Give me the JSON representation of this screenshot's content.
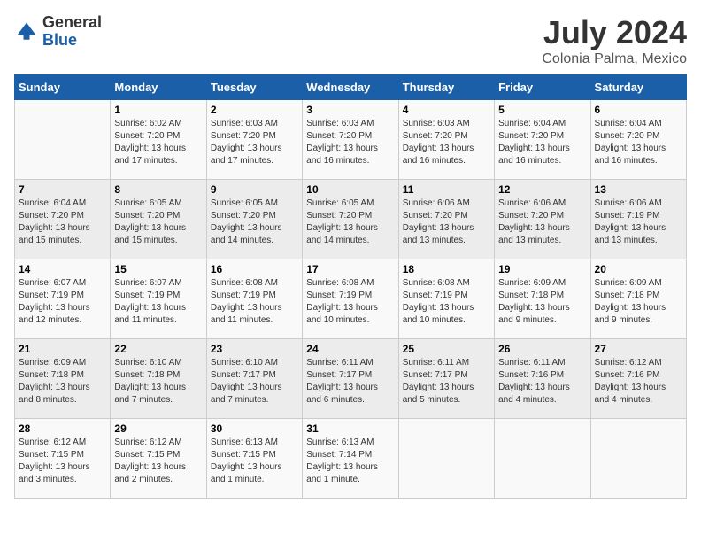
{
  "logo": {
    "general": "General",
    "blue": "Blue"
  },
  "title": "July 2024",
  "location": "Colonia Palma, Mexico",
  "days_of_week": [
    "Sunday",
    "Monday",
    "Tuesday",
    "Wednesday",
    "Thursday",
    "Friday",
    "Saturday"
  ],
  "weeks": [
    [
      {
        "day": "",
        "sunrise": "",
        "sunset": "",
        "daylight": ""
      },
      {
        "day": "1",
        "sunrise": "Sunrise: 6:02 AM",
        "sunset": "Sunset: 7:20 PM",
        "daylight": "Daylight: 13 hours and 17 minutes."
      },
      {
        "day": "2",
        "sunrise": "Sunrise: 6:03 AM",
        "sunset": "Sunset: 7:20 PM",
        "daylight": "Daylight: 13 hours and 17 minutes."
      },
      {
        "day": "3",
        "sunrise": "Sunrise: 6:03 AM",
        "sunset": "Sunset: 7:20 PM",
        "daylight": "Daylight: 13 hours and 16 minutes."
      },
      {
        "day": "4",
        "sunrise": "Sunrise: 6:03 AM",
        "sunset": "Sunset: 7:20 PM",
        "daylight": "Daylight: 13 hours and 16 minutes."
      },
      {
        "day": "5",
        "sunrise": "Sunrise: 6:04 AM",
        "sunset": "Sunset: 7:20 PM",
        "daylight": "Daylight: 13 hours and 16 minutes."
      },
      {
        "day": "6",
        "sunrise": "Sunrise: 6:04 AM",
        "sunset": "Sunset: 7:20 PM",
        "daylight": "Daylight: 13 hours and 16 minutes."
      }
    ],
    [
      {
        "day": "7",
        "sunrise": "Sunrise: 6:04 AM",
        "sunset": "Sunset: 7:20 PM",
        "daylight": "Daylight: 13 hours and 15 minutes."
      },
      {
        "day": "8",
        "sunrise": "Sunrise: 6:05 AM",
        "sunset": "Sunset: 7:20 PM",
        "daylight": "Daylight: 13 hours and 15 minutes."
      },
      {
        "day": "9",
        "sunrise": "Sunrise: 6:05 AM",
        "sunset": "Sunset: 7:20 PM",
        "daylight": "Daylight: 13 hours and 14 minutes."
      },
      {
        "day": "10",
        "sunrise": "Sunrise: 6:05 AM",
        "sunset": "Sunset: 7:20 PM",
        "daylight": "Daylight: 13 hours and 14 minutes."
      },
      {
        "day": "11",
        "sunrise": "Sunrise: 6:06 AM",
        "sunset": "Sunset: 7:20 PM",
        "daylight": "Daylight: 13 hours and 13 minutes."
      },
      {
        "day": "12",
        "sunrise": "Sunrise: 6:06 AM",
        "sunset": "Sunset: 7:20 PM",
        "daylight": "Daylight: 13 hours and 13 minutes."
      },
      {
        "day": "13",
        "sunrise": "Sunrise: 6:06 AM",
        "sunset": "Sunset: 7:19 PM",
        "daylight": "Daylight: 13 hours and 13 minutes."
      }
    ],
    [
      {
        "day": "14",
        "sunrise": "Sunrise: 6:07 AM",
        "sunset": "Sunset: 7:19 PM",
        "daylight": "Daylight: 13 hours and 12 minutes."
      },
      {
        "day": "15",
        "sunrise": "Sunrise: 6:07 AM",
        "sunset": "Sunset: 7:19 PM",
        "daylight": "Daylight: 13 hours and 11 minutes."
      },
      {
        "day": "16",
        "sunrise": "Sunrise: 6:08 AM",
        "sunset": "Sunset: 7:19 PM",
        "daylight": "Daylight: 13 hours and 11 minutes."
      },
      {
        "day": "17",
        "sunrise": "Sunrise: 6:08 AM",
        "sunset": "Sunset: 7:19 PM",
        "daylight": "Daylight: 13 hours and 10 minutes."
      },
      {
        "day": "18",
        "sunrise": "Sunrise: 6:08 AM",
        "sunset": "Sunset: 7:19 PM",
        "daylight": "Daylight: 13 hours and 10 minutes."
      },
      {
        "day": "19",
        "sunrise": "Sunrise: 6:09 AM",
        "sunset": "Sunset: 7:18 PM",
        "daylight": "Daylight: 13 hours and 9 minutes."
      },
      {
        "day": "20",
        "sunrise": "Sunrise: 6:09 AM",
        "sunset": "Sunset: 7:18 PM",
        "daylight": "Daylight: 13 hours and 9 minutes."
      }
    ],
    [
      {
        "day": "21",
        "sunrise": "Sunrise: 6:09 AM",
        "sunset": "Sunset: 7:18 PM",
        "daylight": "Daylight: 13 hours and 8 minutes."
      },
      {
        "day": "22",
        "sunrise": "Sunrise: 6:10 AM",
        "sunset": "Sunset: 7:18 PM",
        "daylight": "Daylight: 13 hours and 7 minutes."
      },
      {
        "day": "23",
        "sunrise": "Sunrise: 6:10 AM",
        "sunset": "Sunset: 7:17 PM",
        "daylight": "Daylight: 13 hours and 7 minutes."
      },
      {
        "day": "24",
        "sunrise": "Sunrise: 6:11 AM",
        "sunset": "Sunset: 7:17 PM",
        "daylight": "Daylight: 13 hours and 6 minutes."
      },
      {
        "day": "25",
        "sunrise": "Sunrise: 6:11 AM",
        "sunset": "Sunset: 7:17 PM",
        "daylight": "Daylight: 13 hours and 5 minutes."
      },
      {
        "day": "26",
        "sunrise": "Sunrise: 6:11 AM",
        "sunset": "Sunset: 7:16 PM",
        "daylight": "Daylight: 13 hours and 4 minutes."
      },
      {
        "day": "27",
        "sunrise": "Sunrise: 6:12 AM",
        "sunset": "Sunset: 7:16 PM",
        "daylight": "Daylight: 13 hours and 4 minutes."
      }
    ],
    [
      {
        "day": "28",
        "sunrise": "Sunrise: 6:12 AM",
        "sunset": "Sunset: 7:15 PM",
        "daylight": "Daylight: 13 hours and 3 minutes."
      },
      {
        "day": "29",
        "sunrise": "Sunrise: 6:12 AM",
        "sunset": "Sunset: 7:15 PM",
        "daylight": "Daylight: 13 hours and 2 minutes."
      },
      {
        "day": "30",
        "sunrise": "Sunrise: 6:13 AM",
        "sunset": "Sunset: 7:15 PM",
        "daylight": "Daylight: 13 hours and 1 minute."
      },
      {
        "day": "31",
        "sunrise": "Sunrise: 6:13 AM",
        "sunset": "Sunset: 7:14 PM",
        "daylight": "Daylight: 13 hours and 1 minute."
      },
      {
        "day": "",
        "sunrise": "",
        "sunset": "",
        "daylight": ""
      },
      {
        "day": "",
        "sunrise": "",
        "sunset": "",
        "daylight": ""
      },
      {
        "day": "",
        "sunrise": "",
        "sunset": "",
        "daylight": ""
      }
    ]
  ]
}
